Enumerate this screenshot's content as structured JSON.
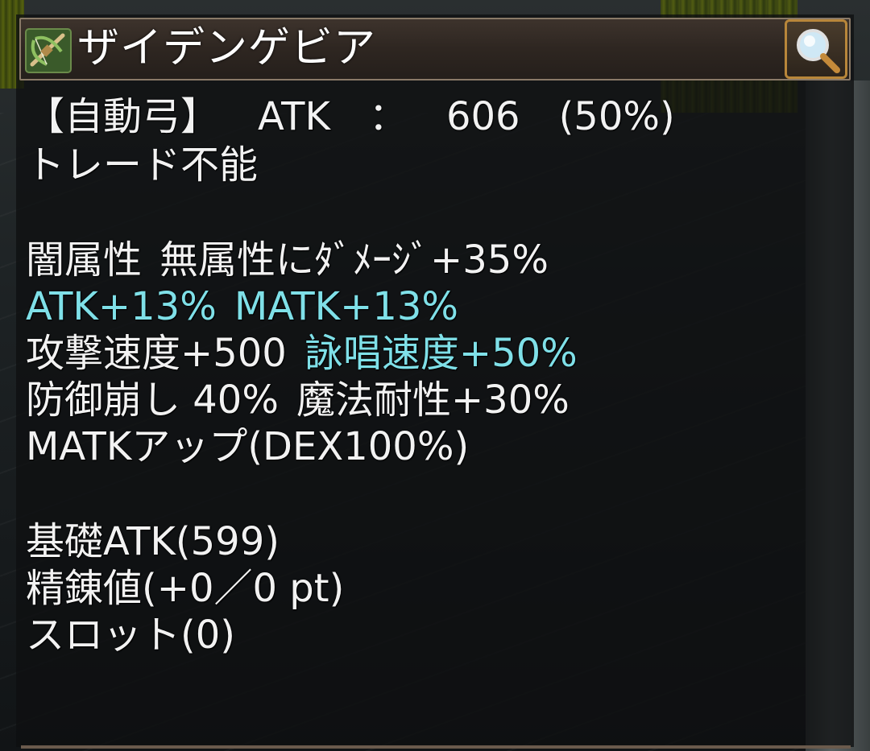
{
  "item": {
    "name": "ザイデンゲビア",
    "icon": "crossbow-icon",
    "inspect_icon": "magnifier-icon"
  },
  "lines": {
    "type_label": "【自動弓】",
    "atk_label": "ATK",
    "atk_sep": "：",
    "atk_value": "606",
    "atk_percent": "(50%)",
    "trade": "トレード不能",
    "element": "闇属性",
    "element_bonus": "無属性にﾀﾞﾒｰｼﾞ+35%",
    "atk_bonus": "ATK+13%",
    "matk_bonus": "MATK+13%",
    "aspd": "攻撃速度+500",
    "cast": "詠唱速度+50%",
    "def_break": "防御崩し 40%",
    "mres": "魔法耐性+30%",
    "matk_up": "MATKアップ(DEX100%)",
    "base_atk": "基礎ATK(599)",
    "refine": "精錬値(+0／0 pt)",
    "slot": "スロット(0)"
  },
  "colors": {
    "text": "#f2f2f2",
    "highlight": "#7fe0e8",
    "title_bar": "#2e2621",
    "button_border": "#b8863a"
  }
}
